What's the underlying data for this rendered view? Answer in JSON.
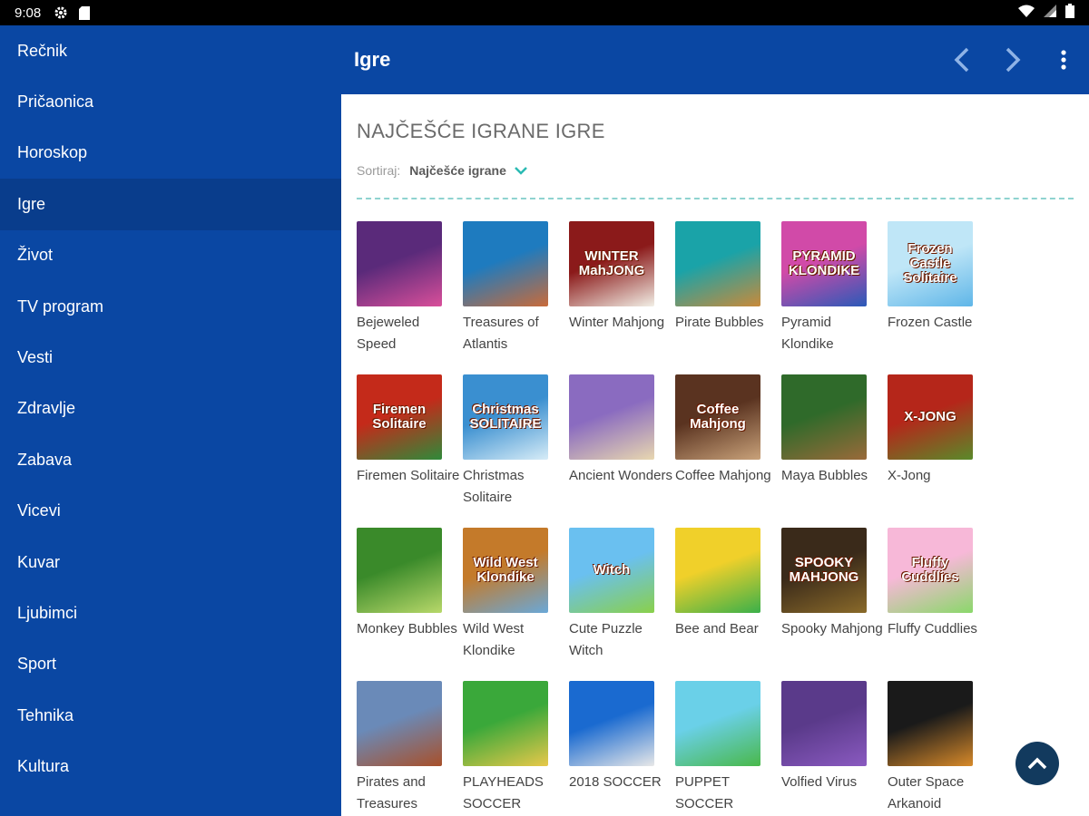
{
  "status": {
    "time": "9:08"
  },
  "sidebar": {
    "items": [
      {
        "label": "Rečnik"
      },
      {
        "label": "Pričaonica"
      },
      {
        "label": "Horoskop"
      },
      {
        "label": "Igre"
      },
      {
        "label": "Život"
      },
      {
        "label": "TV program"
      },
      {
        "label": "Vesti"
      },
      {
        "label": "Zdravlje"
      },
      {
        "label": "Zabava"
      },
      {
        "label": "Vicevi"
      },
      {
        "label": "Kuvar"
      },
      {
        "label": "Ljubimci"
      },
      {
        "label": "Sport"
      },
      {
        "label": "Tehnika"
      },
      {
        "label": "Kultura"
      }
    ],
    "active_index": 3
  },
  "appbar": {
    "title": "Igre"
  },
  "content": {
    "section_title": "NAJČEŠĆE IGRANE IGRE",
    "sort_label": "Sortiraj:",
    "sort_value": "Najčešće igrane"
  },
  "games": [
    {
      "name": "Bejeweled Speed",
      "c1": "#5a2a7a",
      "c2": "#d94f9a"
    },
    {
      "name": "Treasures of Atlantis",
      "c1": "#1e7bbf",
      "c2": "#c96b3a"
    },
    {
      "name": "Winter Mahjong",
      "c1": "#8b1a1a",
      "c2": "#f2efe6",
      "thumb_text": "WINTER MahJONG"
    },
    {
      "name": "Pirate Bubbles",
      "c1": "#1aa3a8",
      "c2": "#c98a3a"
    },
    {
      "name": "Pyramid Klondike",
      "c1": "#d14aa8",
      "c2": "#2a5ab8",
      "thumb_text": "PYRAMID KLONDIKE"
    },
    {
      "name": "Frozen Castle",
      "c1": "#bfe6f7",
      "c2": "#5fb6e8",
      "thumb_text": "Frozen Castle Solitaire"
    },
    {
      "name": "Firemen Solitaire",
      "c1": "#c42a1a",
      "c2": "#2f8a3a",
      "thumb_text": "Firemen Solitaire"
    },
    {
      "name": "Christmas Solitaire",
      "c1": "#3a8fd0",
      "c2": "#d7ecf7",
      "thumb_text": "Christmas SOLITAIRE"
    },
    {
      "name": "Ancient Wonders",
      "c1": "#8a6bc0",
      "c2": "#e8d7b0"
    },
    {
      "name": "Coffee Mahjong",
      "c1": "#5a3320",
      "c2": "#c9a27a",
      "thumb_text": "Coffee Mahjong"
    },
    {
      "name": "Maya Bubbles",
      "c1": "#2f6a2a",
      "c2": "#9a6a3a"
    },
    {
      "name": "X-Jong",
      "c1": "#b5261a",
      "c2": "#5a8a2a",
      "thumb_text": "X-JONG"
    },
    {
      "name": "Monkey Bubbles",
      "c1": "#3a8a2a",
      "c2": "#b8d86a"
    },
    {
      "name": "Wild West Klondike",
      "c1": "#c47a2a",
      "c2": "#6aa8d8",
      "thumb_text": "Wild West Klondike"
    },
    {
      "name": "Cute Puzzle Witch",
      "c1": "#6ac0f0",
      "c2": "#8ad04a",
      "thumb_text": "Witch"
    },
    {
      "name": "Bee and Bear",
      "c1": "#f0d02a",
      "c2": "#3ab04a"
    },
    {
      "name": "Spooky Mahjong",
      "c1": "#3a2a1a",
      "c2": "#8a6a2a",
      "thumb_text": "SPOOKY MAHJONG"
    },
    {
      "name": "Fluffy Cuddlies",
      "c1": "#f7b8d8",
      "c2": "#8ad86a",
      "thumb_text": "Fluffy Cuddlies"
    },
    {
      "name": "Pirates and Treasures",
      "c1": "#6a8ab8",
      "c2": "#a8502a"
    },
    {
      "name": "PLAYHEADS SOCCER",
      "c1": "#3aa83a",
      "c2": "#e8c84a"
    },
    {
      "name": "2018 SOCCER",
      "c1": "#1a6ad0",
      "c2": "#e8e8e8"
    },
    {
      "name": "PUPPET SOCCER",
      "c1": "#6ad0e8",
      "c2": "#4ab84a"
    },
    {
      "name": "Volfied Virus",
      "c1": "#5a3a8a",
      "c2": "#8a5ac0"
    },
    {
      "name": "Outer Space Arkanoid",
      "c1": "#1a1a1a",
      "c2": "#d88a2a"
    }
  ]
}
